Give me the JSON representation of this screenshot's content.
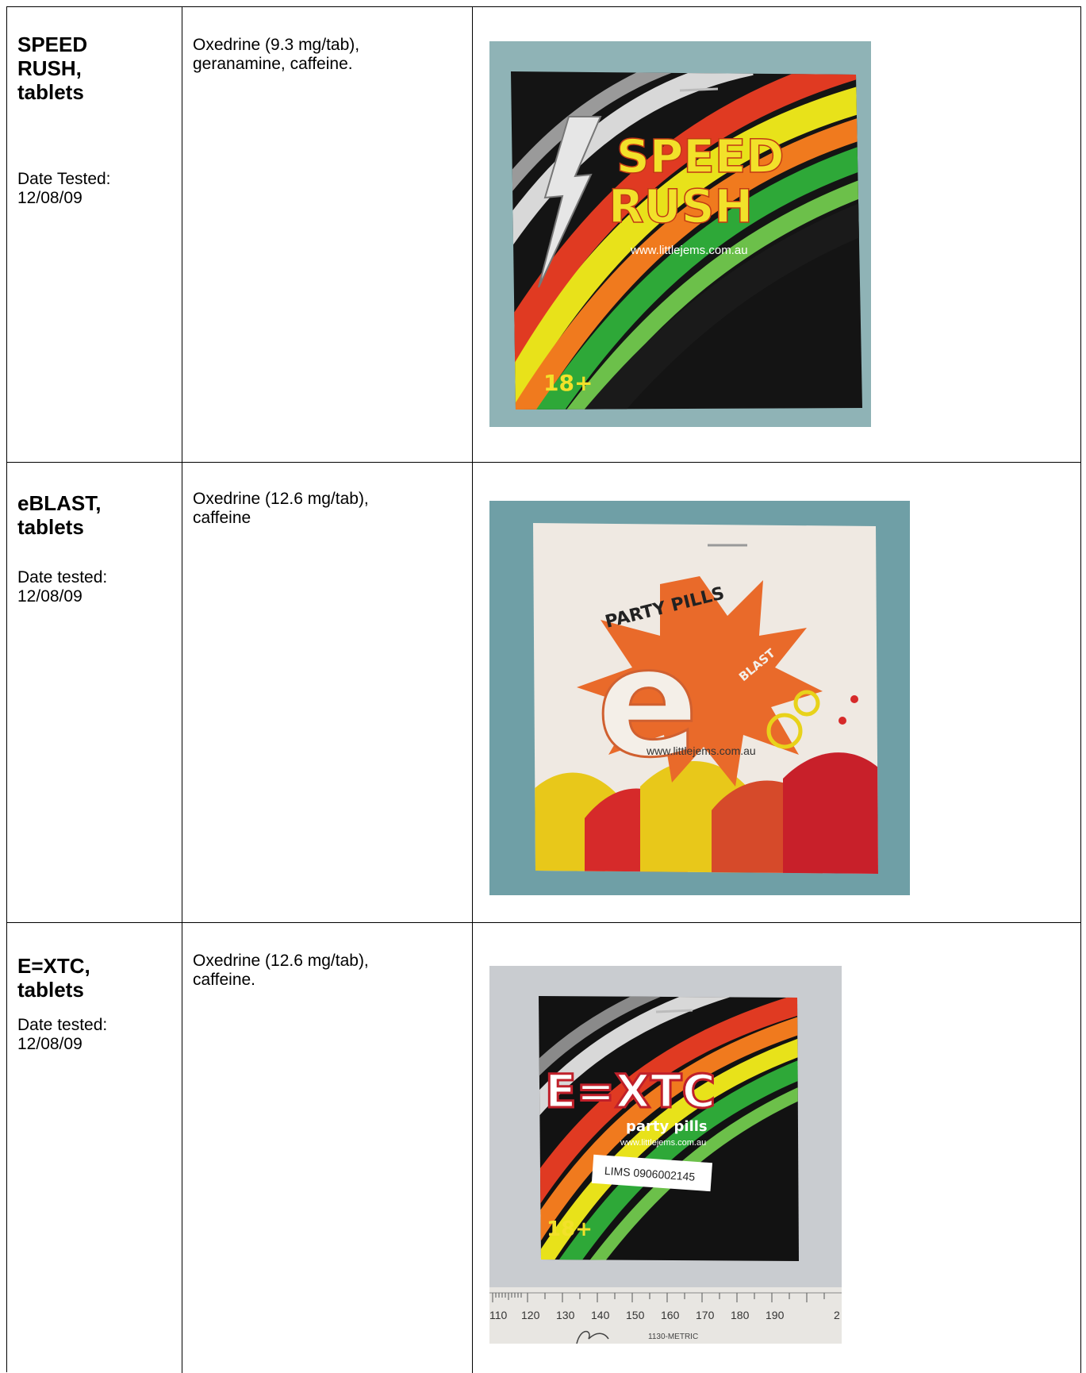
{
  "rows": [
    {
      "name_lines": [
        "SPEED",
        "RUSH,",
        "tablets"
      ],
      "date_lines": [
        "Date Tested:",
        "12/08/09"
      ],
      "composition_lines": [
        "Oxedrine (9.3 mg/tab),",
        "geranamine, caffeine."
      ],
      "photo": {
        "brand_lines": [
          "SPEED",
          "RUSH"
        ],
        "url": "www.littlejems.com.au",
        "age_badge": "18+"
      }
    },
    {
      "name_lines": [
        "eBLAST,",
        "tablets"
      ],
      "date_lines": [
        "Date tested:",
        "12/08/09"
      ],
      "composition_lines": [
        "Oxedrine (12.6 mg/tab),",
        "caffeine"
      ],
      "photo": {
        "tagline": "PARTY PILLS",
        "logo_letter": "e",
        "logo_word": "BLAST",
        "url": "www.littlejems.com.au"
      }
    },
    {
      "name_lines": [
        "E=XTC,",
        "tablets"
      ],
      "date_lines": [
        "Date tested:",
        "12/08/09"
      ],
      "composition_lines": [
        "Oxedrine (12.6 mg/tab),",
        "caffeine."
      ],
      "photo": {
        "brand": "E=XTC",
        "tagline": "party pills",
        "url": "www.littlejems.com.au",
        "label": "LIMS 0906002145",
        "age_badge": "18+",
        "ruler_ticks": [
          "110",
          "120",
          "130",
          "140",
          "150",
          "160",
          "170",
          "180",
          "190",
          "2"
        ],
        "ruler_brand": "1130-METRIC"
      }
    }
  ]
}
